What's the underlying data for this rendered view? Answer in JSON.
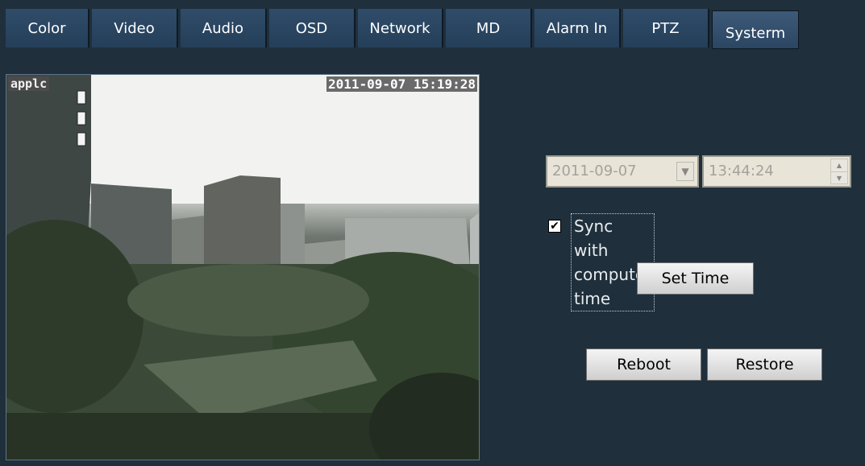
{
  "tabs": [
    {
      "label": "Color"
    },
    {
      "label": "Video"
    },
    {
      "label": "Audio"
    },
    {
      "label": "OSD"
    },
    {
      "label": "Network"
    },
    {
      "label": "MD"
    },
    {
      "label": "Alarm In"
    },
    {
      "label": "PTZ"
    },
    {
      "label": "Systerm"
    }
  ],
  "active_tab": "Systerm",
  "video": {
    "camera_name": "applc",
    "timestamp": "2011-09-07 15:19:28"
  },
  "system": {
    "date_value": "2011-09-07",
    "time_value": "13:44:24",
    "sync_label": "Sync with computer time",
    "sync_checked": true,
    "set_time_label": "Set Time",
    "reboot_label": "Reboot",
    "restore_label": "Restore"
  },
  "colors": {
    "background": "#1f2f3c",
    "tab": "#2f4c69",
    "disabled_field": "#e8e4d8"
  }
}
